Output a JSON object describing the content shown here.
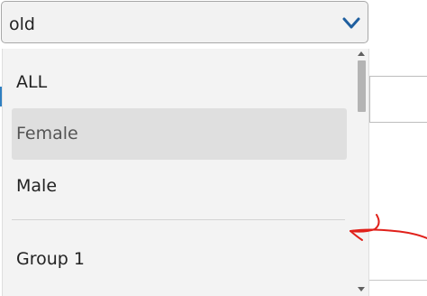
{
  "select": {
    "value": "old",
    "toggle_icon": "chevron-down-icon"
  },
  "dropdown": {
    "options": [
      {
        "label": "ALL"
      },
      {
        "label": "Female"
      },
      {
        "label": "Male"
      },
      {
        "label": "Group 1"
      }
    ],
    "selected_index": 1
  },
  "annotation": {
    "icon": "hand-drawn-arrow-icon",
    "color": "#e0211b"
  },
  "colors": {
    "chevron": "#1f5f9f",
    "accent": "#2f7fc1",
    "panel_bg": "#f3f3f3",
    "selected_bg": "#dfdfdf"
  }
}
